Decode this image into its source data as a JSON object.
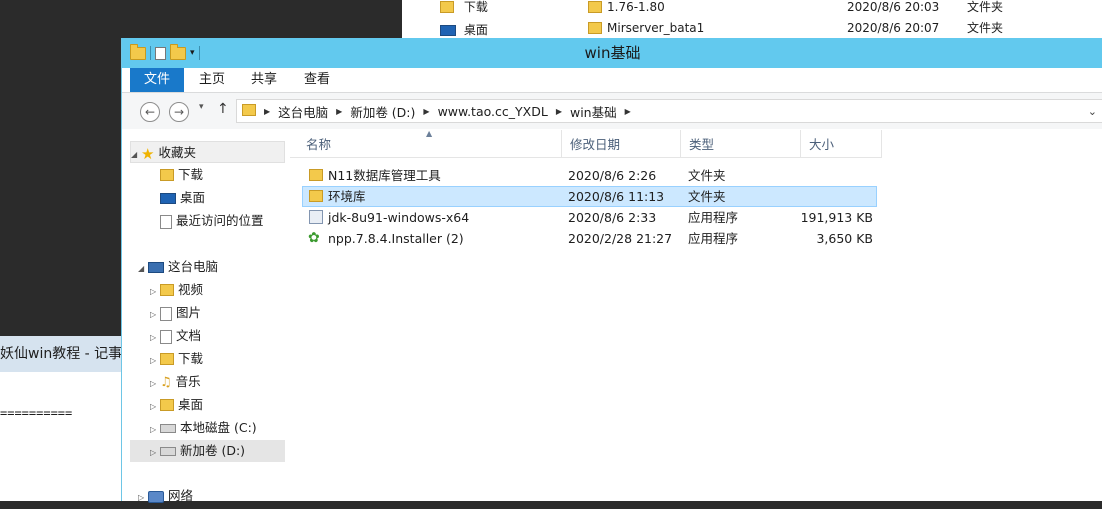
{
  "background_explorer": {
    "nav_items": [
      {
        "label": "下载",
        "icon": "folder-download-icon"
      },
      {
        "label": "桌面",
        "icon": "desktop-icon"
      }
    ],
    "rows": [
      {
        "name": "1.76-1.80",
        "date": "2020/8/6 20:03",
        "type": "文件夹"
      },
      {
        "name": "Mirserver_bata1",
        "date": "2020/8/6 20:07",
        "type": "文件夹"
      }
    ]
  },
  "notepad": {
    "title": "妖仙win教程 - 记事",
    "text": "=========="
  },
  "window": {
    "title": "win基础",
    "ribbon_tabs": [
      "文件",
      "主页",
      "共享",
      "查看"
    ],
    "address": {
      "crumbs": [
        "这台电脑",
        "新加卷 (D:)",
        "www.tao.cc_YXDL",
        "win基础"
      ]
    },
    "nav": {
      "favorites": "收藏夹",
      "favorites_items": [
        "下载",
        "桌面",
        "最近访问的位置"
      ],
      "this_pc": "这台电脑",
      "pc_items": [
        "视频",
        "图片",
        "文档",
        "下载",
        "音乐",
        "桌面",
        "本地磁盘 (C:)",
        "新加卷 (D:)"
      ],
      "network": "网络"
    },
    "columns": [
      "名称",
      "修改日期",
      "类型",
      "大小"
    ],
    "files": [
      {
        "name": "N11数据库管理工具",
        "date": "2020/8/6 2:26",
        "type": "文件夹",
        "size": "",
        "icon": "folder-icon"
      },
      {
        "name": "环境库",
        "date": "2020/8/6 11:13",
        "type": "文件夹",
        "size": "",
        "icon": "folder-icon"
      },
      {
        "name": "jdk-8u91-windows-x64",
        "date": "2020/8/6 2:33",
        "type": "应用程序",
        "size": "191,913 KB",
        "icon": "java-installer-icon"
      },
      {
        "name": "npp.7.8.4.Installer (2)",
        "date": "2020/2/28 21:27",
        "type": "应用程序",
        "size": "3,650 KB",
        "icon": "notepad-plus-plus-icon"
      }
    ]
  }
}
